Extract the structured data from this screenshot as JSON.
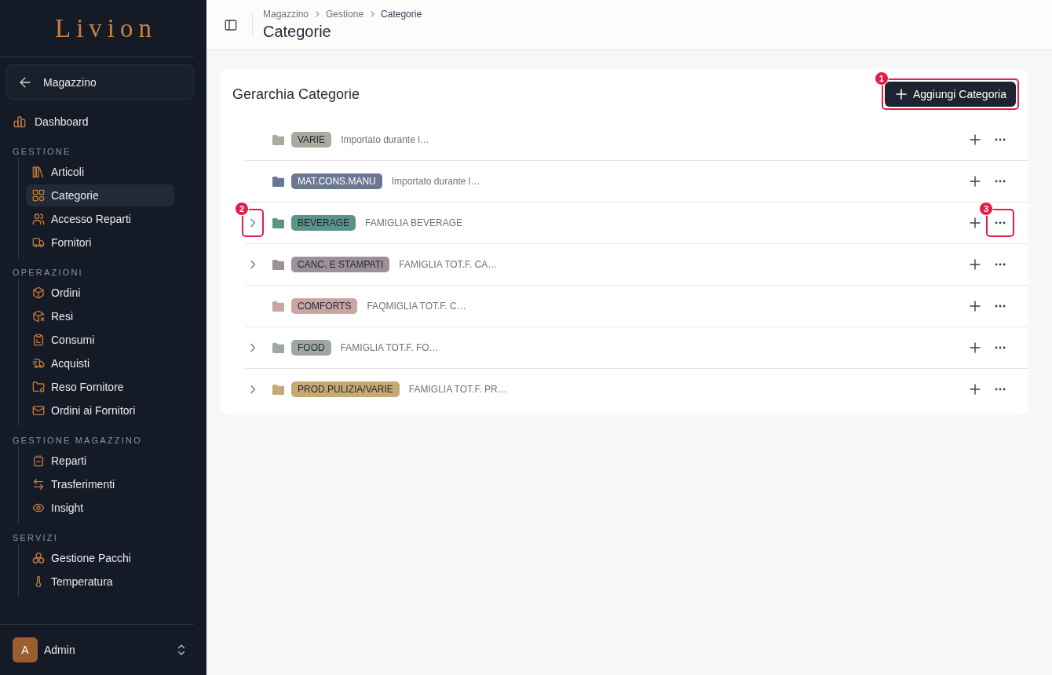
{
  "sidebar": {
    "logo": "Livion",
    "back_button": "Magazzino",
    "items": [
      {
        "label": "Dashboard",
        "selected": false
      }
    ],
    "sections": [
      {
        "title": "GESTIONE",
        "items": [
          {
            "label": "Articoli",
            "selected": false
          },
          {
            "label": "Categorie",
            "selected": true
          },
          {
            "label": "Accesso Reparti",
            "selected": false
          },
          {
            "label": "Fornitori",
            "selected": false
          }
        ]
      },
      {
        "title": "OPERAZIONI",
        "items": [
          {
            "label": "Ordini",
            "selected": false
          },
          {
            "label": "Resi",
            "selected": false
          },
          {
            "label": "Consumi",
            "selected": false
          },
          {
            "label": "Acquisti",
            "selected": false
          },
          {
            "label": "Reso Fornitore",
            "selected": false
          },
          {
            "label": "Ordini ai Fornitori",
            "selected": false
          }
        ]
      },
      {
        "title": "GESTIONE MAGAZZINO",
        "items": [
          {
            "label": "Reparti",
            "selected": false
          },
          {
            "label": "Trasferimenti",
            "selected": false
          },
          {
            "label": "Insight",
            "selected": false
          }
        ]
      },
      {
        "title": "SERVIZI",
        "items": [
          {
            "label": "Gestione Pacchi",
            "selected": false
          },
          {
            "label": "Temperatura",
            "selected": false
          }
        ]
      }
    ],
    "user": {
      "initial": "A",
      "name": "Admin"
    }
  },
  "header": {
    "breadcrumb": [
      "Magazzino",
      "Gestione",
      "Categorie"
    ],
    "title": "Categorie"
  },
  "card": {
    "title": "Gerarchia Categorie",
    "add_button": {
      "label": "Aggiungi Categoria",
      "callout": "1"
    },
    "rows": [
      {
        "name": "VARIE",
        "description": "Importato durante l…",
        "color": "#a9ab9e",
        "expandable": false
      },
      {
        "name": "MAT.CONS.MANU",
        "description": "Importato durante l…",
        "color": "#6b7891",
        "expandable": false
      },
      {
        "name": "BEVERAGE",
        "description": "FAMIGLIA BEVERAGE",
        "color": "#5b9487",
        "expandable": true,
        "expander_callout": "2",
        "menu_callout": "3"
      },
      {
        "name": "CANC. E STAMPATI",
        "description": "FAMIGLIA TOT.F. CA…",
        "color": "#9e9099",
        "expandable": true
      },
      {
        "name": "COMFORTS",
        "description": "FAQMIGLIA TOT.F. C…",
        "color": "#c9a6a3",
        "expandable": false
      },
      {
        "name": "FOOD",
        "description": "FAMIGLIA TOT.F. FO…",
        "color": "#9fa89f",
        "expandable": true
      },
      {
        "name": "PROD.PULIZIA/VARIE",
        "description": "FAMIGLIA TOT.F. PR…",
        "color": "#c8a873",
        "expandable": true
      }
    ]
  }
}
